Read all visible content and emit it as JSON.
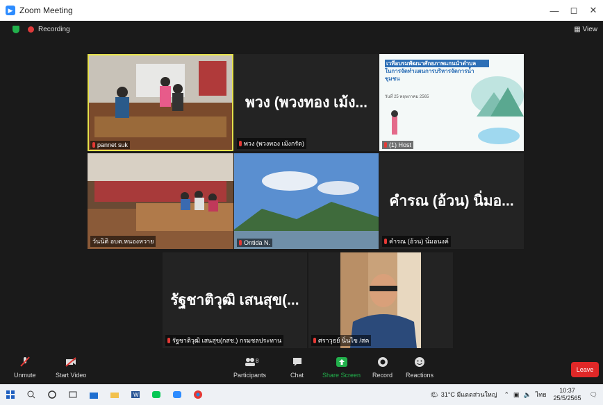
{
  "window": {
    "title": "Zoom Meeting",
    "controls": [
      "—",
      "◻",
      "✕"
    ]
  },
  "meeting": {
    "recording_label": "Recording",
    "view_label": "View"
  },
  "tiles": [
    {
      "name": "pannet suk",
      "big": ""
    },
    {
      "name": "พวง (พวงทอง เม้งกรัด)",
      "big": "พวง (พวงทอง เม้ง..."
    },
    {
      "name": "(1) Host",
      "big": ""
    },
    {
      "name": "วันนิติ อบต.หนองหวาย",
      "big": ""
    },
    {
      "name": "Ontida N.",
      "big": ""
    },
    {
      "name": "คำรณ (อ้วน) นิ่มอนงค์",
      "big": "คำรณ (อ้วน) นิ่มอ..."
    },
    {
      "name": "รัฐชาติวุฒิ เสนสุข(กสช.) กรมชลประทาน",
      "big": "รัฐชาติวุฒิ เสนสุข(..."
    },
    {
      "name": "ศราวุธย์ นิ่นไข /สค",
      "big": ""
    }
  ],
  "slide": {
    "title": "เวทีอบรมพัฒนาศักยภาพแกนนำตำบล",
    "subtitle": "ในการจัดทำแผนการบริหารจัดการน้ำชุมชน",
    "date": "วันที่ 25 พฤษภาคม 2565"
  },
  "toolbar": {
    "unmute": "Unmute",
    "start_video": "Start Video",
    "participants": "Participants",
    "participants_count": "8",
    "chat": "Chat",
    "share_screen": "Share Screen",
    "record": "Record",
    "reactions": "Reactions",
    "leave": "Leave"
  },
  "taskbar": {
    "weather": "31°C มีแดดส่วนใหญ่",
    "lang": "ไทย",
    "time": "10:37",
    "date": "25/5/2565"
  },
  "colors": {
    "share_green": "#22b14c",
    "leave_red": "#e02828",
    "active_border": "#e6e24b",
    "zoom_blue": "#2d8cff"
  }
}
